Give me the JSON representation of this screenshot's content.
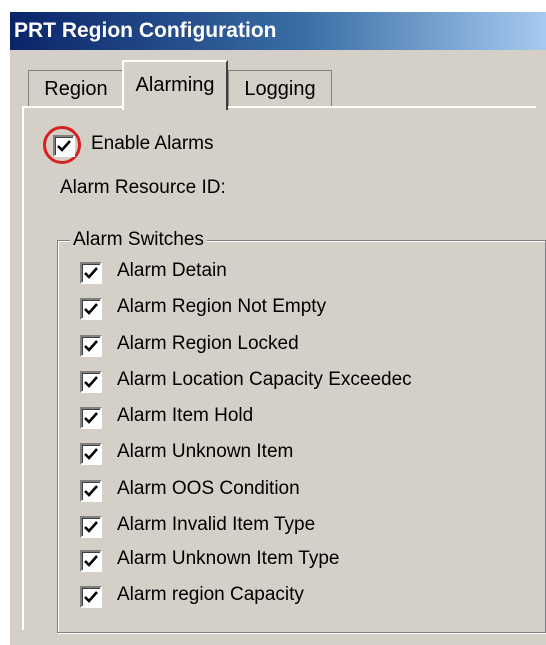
{
  "window": {
    "title": "PRT Region Configuration"
  },
  "tabs": [
    {
      "label": "Region"
    },
    {
      "label": "Alarming"
    },
    {
      "label": "Logging"
    }
  ],
  "alarming": {
    "enable_alarms": {
      "label": "Enable Alarms",
      "checked": true
    },
    "resource_id_label": "Alarm Resource ID:",
    "switches_group_label": "Alarm Switches",
    "switches": [
      {
        "label": "Alarm Detain",
        "checked": true
      },
      {
        "label": "Alarm Region Not Empty",
        "checked": true
      },
      {
        "label": "Alarm Region Locked",
        "checked": true
      },
      {
        "label": "Alarm Location Capacity Exceedec",
        "checked": true
      },
      {
        "label": "Alarm Item Hold",
        "checked": true
      },
      {
        "label": "Alarm Unknown Item",
        "checked": true
      },
      {
        "label": "Alarm OOS Condition",
        "checked": true
      },
      {
        "label": "Alarm Invalid Item Type",
        "checked": true
      },
      {
        "label": "Alarm Unknown Item Type",
        "checked": true
      },
      {
        "label": "Alarm region Capacity",
        "checked": true
      }
    ]
  },
  "colors": {
    "window_bg": "#d4d0c8",
    "title_start": "#0a246a",
    "title_end": "#a6caf0",
    "highlight": "#d62020"
  },
  "icons": {
    "check": "checkmark-icon"
  }
}
